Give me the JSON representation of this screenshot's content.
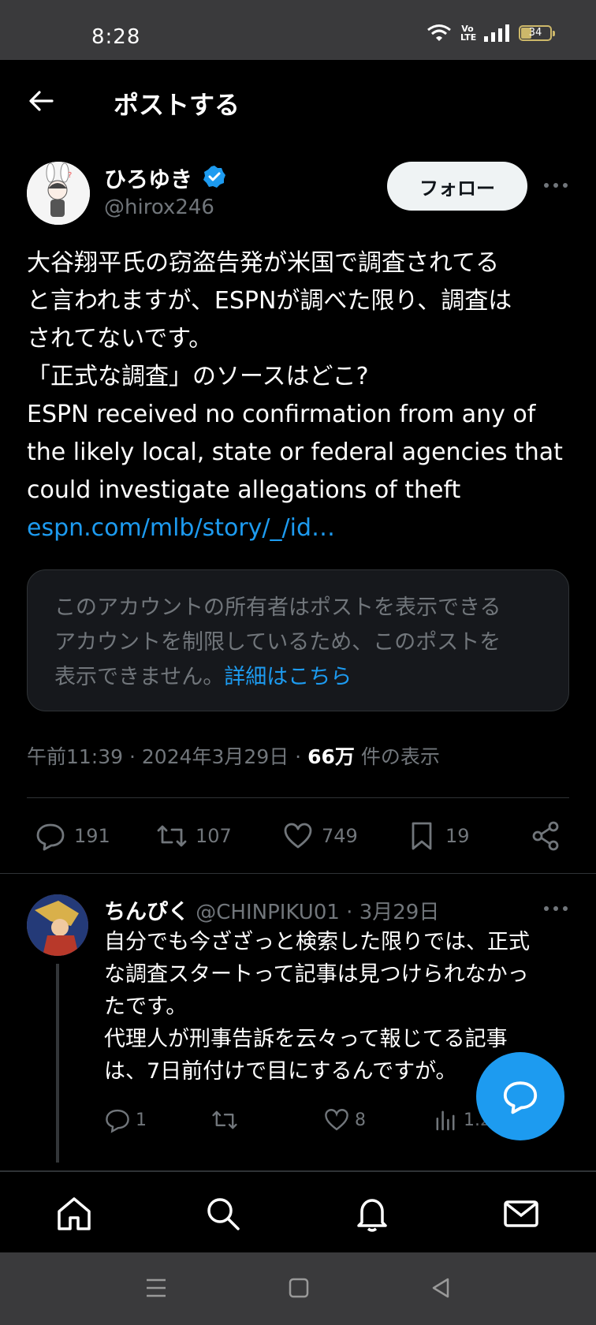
{
  "status_bar": {
    "time": "8:28",
    "volte_line1": "Vo",
    "volte_line2": "LTE",
    "battery": "34"
  },
  "header": {
    "title": "ポストする"
  },
  "tweet": {
    "author_name": "ひろゆき",
    "author_handle": "@hirox246",
    "follow_label": "フォロー",
    "text_lines": [
      "大谷翔平氏の窃盗告発が米国で調査されてる",
      "と言われますが、ESPNが調べた限り、調査は",
      "されてないです。",
      "「正式な調査」のソースはどこ?",
      "ESPN received no confirmation from any of",
      "the likely local, state or federal agencies that",
      "could investigate allegations of theft"
    ],
    "link": "espn.com/mlb/story/_/id…",
    "restricted_lines": [
      "このアカウントの所有者はポストを表示できる",
      "アカウントを制限しているため、このポストを",
      "表示できません。"
    ],
    "restricted_link": "詳細はこちら",
    "meta_time": "午前11:39 · 2024年3月29日 · ",
    "meta_views": "66万",
    "meta_views_label": " 件の表示",
    "replies": "191",
    "retweets": "107",
    "likes": "749",
    "bookmarks": "19"
  },
  "reply": {
    "name": "ちんぴく",
    "handle_date": " @CHINPIKU01 · 3月29日",
    "lines": [
      "自分でも今ざざっと検索した限りでは、正式",
      "な調査スタートって記事は見つけられなかっ",
      "たです。",
      "代理人が刑事告訴を云々って報じてる記事",
      "は、7日前付けで目にするんですが。"
    ],
    "replies": "1",
    "likes": "8",
    "views": "1.2"
  },
  "colors": {
    "accent": "#1d9bf0",
    "background": "#000000",
    "muted": "#71767b"
  },
  "icons": [
    "back-arrow-icon",
    "verified-badge-icon",
    "more-icon",
    "reply-icon",
    "retweet-icon",
    "like-icon",
    "bookmark-icon",
    "share-icon",
    "views-icon",
    "compose-icon",
    "home-icon",
    "search-icon",
    "notifications-icon",
    "messages-icon"
  ]
}
